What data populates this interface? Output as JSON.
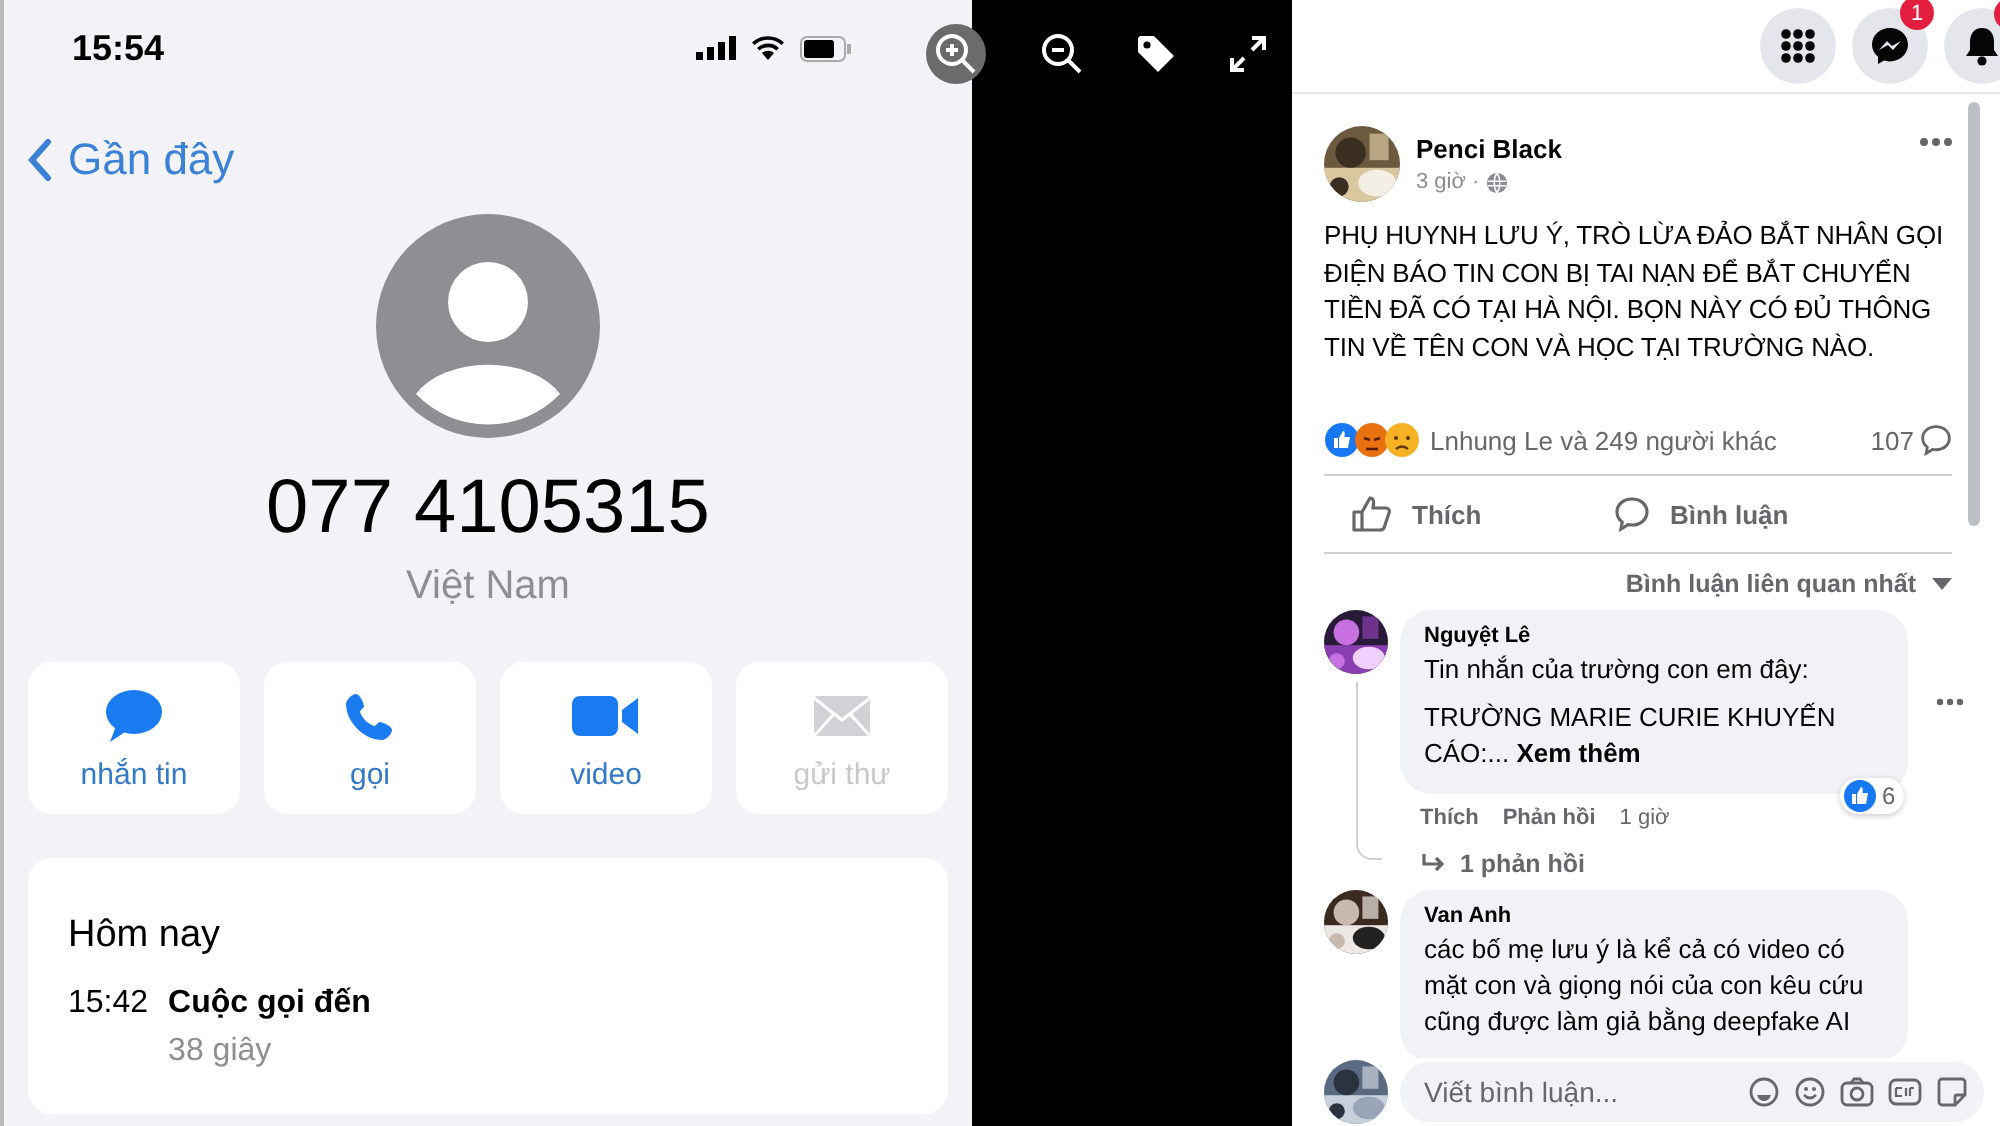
{
  "phone": {
    "status_time": "15:54",
    "back_label": "Gần đây",
    "number": "077 4105315",
    "country": "Việt Nam",
    "actions": [
      {
        "kind": "message",
        "label": "nhắn tin",
        "disabled": false
      },
      {
        "kind": "call",
        "label": "gọi",
        "disabled": false
      },
      {
        "kind": "video",
        "label": "video",
        "disabled": false
      },
      {
        "kind": "mail",
        "label": "gửi thư",
        "disabled": true
      }
    ],
    "history": {
      "heading": "Hôm nay",
      "entries": [
        {
          "time": "15:42",
          "type": "Cuộc gọi đến",
          "duration": "38 giây"
        }
      ]
    }
  },
  "viewer_tools": [
    {
      "kind": "zoom-in"
    },
    {
      "kind": "zoom-out"
    },
    {
      "kind": "tag"
    },
    {
      "kind": "fullscreen"
    }
  ],
  "top_bar": [
    {
      "kind": "menu"
    },
    {
      "kind": "messenger",
      "badge": "1"
    },
    {
      "kind": "notifications",
      "alert": true
    }
  ],
  "post": {
    "author": "Penci Black",
    "time": "3 giờ ·",
    "text": "PHỤ HUYNH LƯU Ý, TRÒ LỪA ĐẢO BẮT NHÂN GỌI ĐIỆN BÁO TIN CON BỊ TAI NẠN ĐỂ BẮT CHUYỂN TIỀN ĐÃ CÓ TẠI HÀ NỘI. BỌN NÀY CÓ ĐỦ THÔNG TIN VỀ TÊN CON VÀ HỌC TẠI TRƯỜNG NÀO.",
    "reactions": "Lnhung Le và 249 người khác",
    "comment_count": "107",
    "actions": [
      {
        "kind": "like",
        "label": "Thích"
      },
      {
        "kind": "comment",
        "label": "Bình luận"
      }
    ],
    "sort": "Bình luận liên quan nhất",
    "comments": [
      {
        "author": "Nguyệt Lê",
        "paragraphs": [
          "Tin nhắn của trường con em đây:",
          "TRƯỜNG MARIE CURIE KHUYẾN CÁO:..."
        ],
        "see_more": "Xem thêm",
        "like": "Thích",
        "reply": "Phản hồi",
        "age": "1 giờ",
        "reaction_count": "6",
        "replies": "1 phản hồi"
      },
      {
        "author": "Van Anh",
        "paragraphs": [
          "các bố mẹ lưu ý là kể cả có video có mặt con và giọng nói của con kêu cứu cũng được làm giả bằng deepfake AI"
        ]
      }
    ],
    "composer": {
      "placeholder": "Viết bình luận..."
    }
  }
}
